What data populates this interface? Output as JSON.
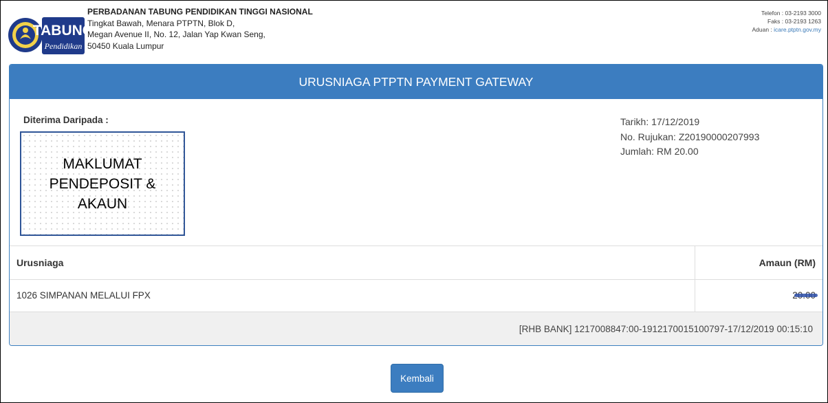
{
  "header": {
    "logo_text_main": "TABUNG",
    "logo_text_sub": "Pendidikan",
    "org_name": "PERBADANAN TABUNG PENDIDIKAN TINGGI NASIONAL",
    "address_line1": "Tingkat Bawah, Menara PTPTN, Blok D,",
    "address_line2": "Megan Avenue II, No. 12, Jalan Yap Kwan Seng,",
    "address_line3": "50450 Kuala Lumpur",
    "telefon": "Telefon : 03-2193 3000",
    "faks": "Faks : 03-2193 1263",
    "aduan_label": "Aduan : ",
    "aduan_link": "icare.ptptn.gov.my"
  },
  "panel": {
    "title": "URUSNIAGA PTPTN PAYMENT GATEWAY",
    "received_from_label": "Diterima Daripada :",
    "depositor_placeholder": "MAKLUMAT\nPENDEPOSIT &\nAKAUN",
    "tarikh": "Tarikh: 17/12/2019",
    "rujukan": "No. Rujukan: Z20190000207993",
    "jumlah": "Jumlah: RM 20.00"
  },
  "table": {
    "headers": [
      "Urusniaga",
      "Amaun (RM)"
    ],
    "rows": [
      {
        "description": "1026 SIMPANAN MELALUI FPX",
        "amount": "20.00"
      }
    ],
    "footer": "[RHB BANK] 1217008847:00-1912170015100797-17/12/2019 00:15:10"
  },
  "buttons": {
    "back": "Kembali"
  },
  "colors": {
    "primary": "#3c7dc0",
    "logo_navy": "#1f3a8a",
    "box_border": "#2f5597"
  }
}
